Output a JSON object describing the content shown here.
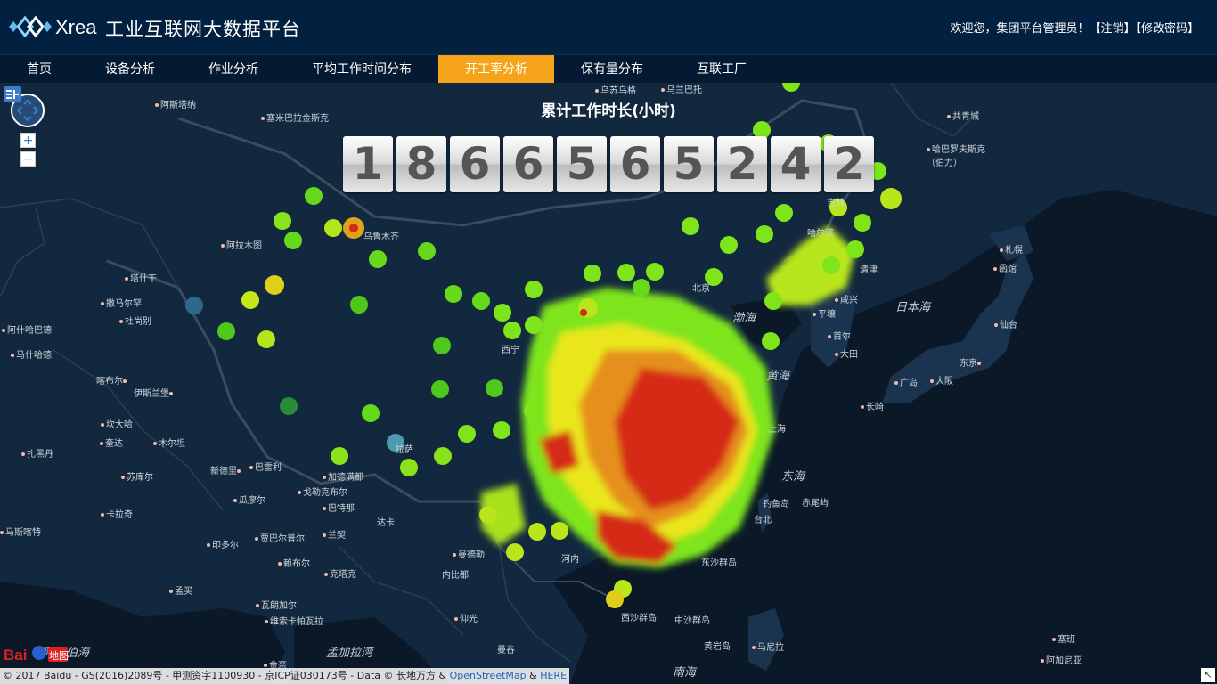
{
  "header": {
    "logo_text": "Xrea",
    "title": "工业互联网大数据平台",
    "welcome_text": "欢迎您，集团平台管理员！",
    "logout_label": "【注销】",
    "change_password_label": "【修改密码】"
  },
  "nav": {
    "items": [
      {
        "label": "首页"
      },
      {
        "label": "设备分析"
      },
      {
        "label": "作业分析"
      },
      {
        "label": "平均工作时间分布"
      },
      {
        "label": "开工率分析",
        "active": true
      },
      {
        "label": "保有量分布"
      },
      {
        "label": "互联工厂"
      }
    ],
    "active_color": "#f5a318"
  },
  "counter": {
    "title": "累计工作时长(小时)",
    "digits": [
      "1",
      "8",
      "6",
      "6",
      "5",
      "6",
      "5",
      "2",
      "4",
      "2"
    ]
  },
  "map": {
    "labels": {
      "l0": "阿斯塔纳",
      "l1": "塞米巴拉金斯克",
      "l2": "乌兰巴托",
      "l3": "乌苏乌格",
      "l4": "共青城",
      "l5": "哈巴罗夫斯克（伯力）",
      "l6": "阿拉木图",
      "l7": "乌鲁木齐",
      "l8": "塔什干",
      "l9": "撒马尔罕",
      "l10": "杜尚别",
      "l11": "阿什哈巴德",
      "l12": "马什哈德",
      "l13": "喀布尔",
      "l14": "伊斯兰堡",
      "l15": "坎大哈",
      "l16": "奎达",
      "l17": "木尔坦",
      "l18": "扎黑丹",
      "l19": "苏库尔",
      "l20": "卡拉奇",
      "l21": "马斯喀特",
      "l22": "新德里",
      "l23": "巴雷利",
      "l24": "加德满都",
      "l25": "瓜廖尔",
      "l26": "戈勒克布尔",
      "l27": "巴特那",
      "l28": "达卡",
      "l29": "印多尔",
      "l30": "贾巴尔普尔",
      "l31": "兰契",
      "l32": "赖布尔",
      "l33": "克塔克",
      "l34": "孟买",
      "l35": "瓦朗加尔",
      "l36": "维索卡帕瓦拉",
      "l37": "孟加拉湾",
      "l38": "阿拉伯海",
      "l39": "金奈",
      "l40": "仰光",
      "l41": "曼谷",
      "l42": "内比都",
      "l43": "曼德勒",
      "l44": "河内",
      "l45": "东沙群岛",
      "l46": "西沙群岛",
      "l47": "中沙群岛",
      "l48": "黄岩岛",
      "l49": "马尼拉",
      "l50": "南海",
      "l51": "钓鱼岛",
      "l52": "赤尾屿",
      "l53": "台北",
      "l54": "东海",
      "l55": "黄海",
      "l56": "渤海",
      "l57": "平壤",
      "l58": "咸兴",
      "l59": "首尔",
      "l60": "大田",
      "l61": "广岛",
      "l62": "大阪",
      "l63": "长崎",
      "l64": "东京",
      "l65": "仙台",
      "l66": "札幌",
      "l67": "函馆",
      "l68": "清津",
      "l69": "日本海",
      "l70": "塞班",
      "l71": "阿加尼亚",
      "l72": "拉萨",
      "l73": "北京",
      "l74": "西宁",
      "l75": "上海",
      "l76": "吉林",
      "l77": "哈尔滨"
    }
  },
  "footer": {
    "copyright_text": "© 2017 Baidu - GS(2016)2089号 - 甲测资字1100930 - 京ICP证030173号 - Data © 长地万方 &",
    "osm_text": "OpenStreetMap",
    "here_amp": "&",
    "here_text": "HERE",
    "baidu_text": "Bai",
    "baidu_text2": "地图"
  }
}
